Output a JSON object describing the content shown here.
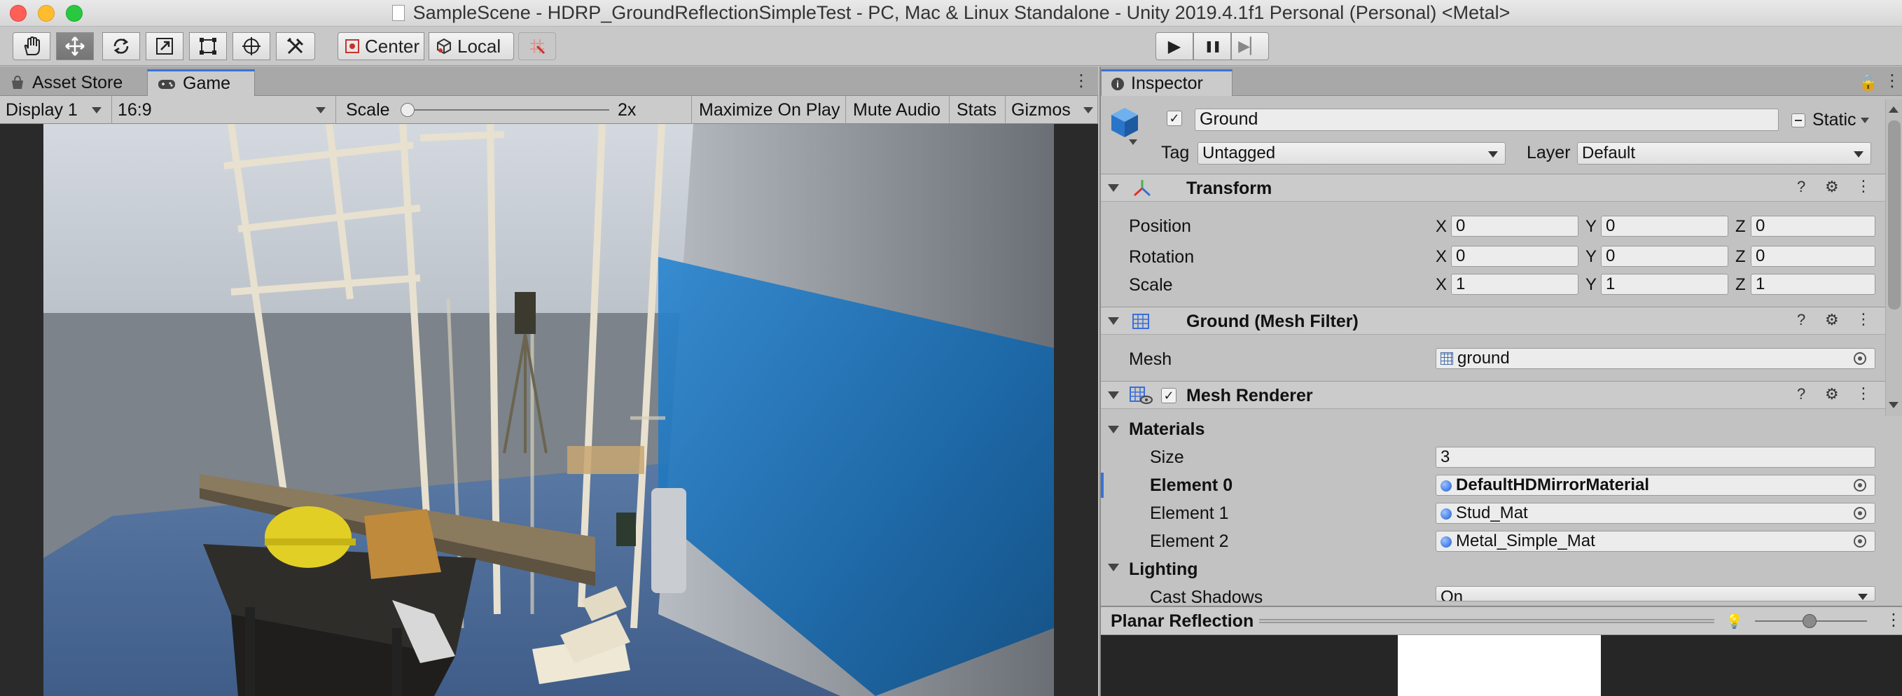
{
  "window_title": "SampleScene - HDRP_GroundReflectionSimpleTest - PC, Mac & Linux Standalone - Unity 2019.4.1f1 Personal (Personal) <Metal>",
  "toolbar": {
    "tools": [
      "hand-tool",
      "move-tool",
      "rotate-tool",
      "scale-tool",
      "rect-tool",
      "transform-tool",
      "custom-tool"
    ],
    "pivot_label": "Center",
    "space_label": "Local",
    "play": "▶",
    "pause": "❚❚",
    "step": "▶▏"
  },
  "game_panel": {
    "tabs": [
      {
        "label": "Asset Store"
      },
      {
        "label": "Game"
      }
    ],
    "display": "Display 1",
    "aspect": "16:9",
    "scale_label": "Scale",
    "scale_value": "2x",
    "scale_fraction": 0.0,
    "buttons": [
      "Maximize On Play",
      "Mute Audio",
      "Stats",
      "Gizmos"
    ]
  },
  "inspector": {
    "tab": "Inspector",
    "object_name": "Ground",
    "object_active": true,
    "static_label": "Static",
    "tag_label": "Tag",
    "tag_value": "Untagged",
    "layer_label": "Layer",
    "layer_value": "Default",
    "transform": {
      "title": "Transform",
      "rows": [
        {
          "label": "Position",
          "x": "0",
          "y": "0",
          "z": "0"
        },
        {
          "label": "Rotation",
          "x": "0",
          "y": "0",
          "z": "0"
        },
        {
          "label": "Scale",
          "x": "1",
          "y": "1",
          "z": "1"
        }
      ],
      "axes": [
        "X",
        "Y",
        "Z"
      ]
    },
    "mesh_filter": {
      "title": "Ground (Mesh Filter)",
      "mesh_label": "Mesh",
      "mesh_value": "ground"
    },
    "mesh_renderer": {
      "title": "Mesh Renderer",
      "enabled": true,
      "materials_label": "Materials",
      "size_label": "Size",
      "size_value": "3",
      "elements": [
        {
          "label": "Element 0",
          "value": "DefaultHDMirrorMaterial"
        },
        {
          "label": "Element 1",
          "value": "Stud_Mat"
        },
        {
          "label": "Element 2",
          "value": "Metal_Simple_Mat"
        }
      ],
      "lighting_label": "Lighting",
      "cast_shadows_label": "Cast Shadows",
      "cast_shadows_value": "On"
    },
    "planar_reflection": {
      "title": "Planar Reflection"
    }
  },
  "colors": {
    "accent": "#3a72d8",
    "panel": "#c2c2c2",
    "header": "#cbcbcb",
    "floor": "#4a6a96",
    "wall_blue": "#1b73b8"
  }
}
